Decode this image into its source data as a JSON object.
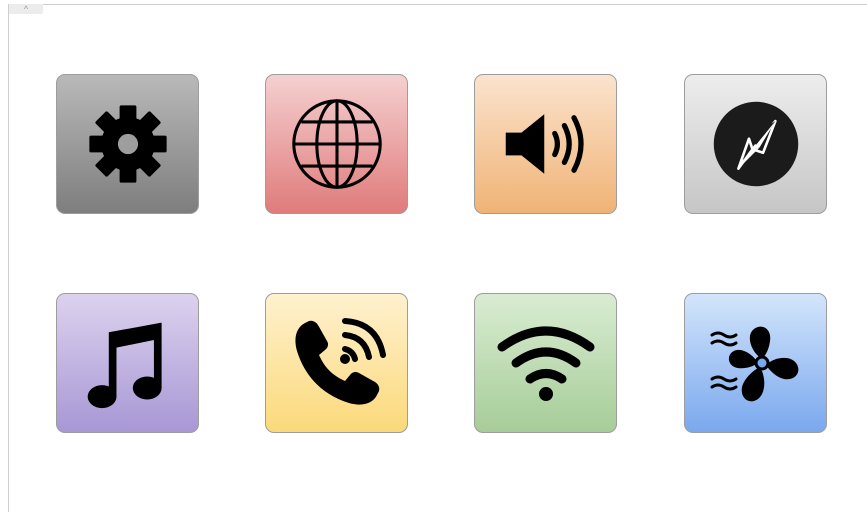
{
  "panel": {
    "collapse_glyph": "^"
  },
  "tiles": [
    {
      "icon": "gear-icon",
      "gradient": [
        "#b9b9b9",
        "#7e7e7e"
      ]
    },
    {
      "icon": "globe-icon",
      "gradient": [
        "#f5d0d0",
        "#e07b7b"
      ]
    },
    {
      "icon": "speaker-icon",
      "gradient": [
        "#fbe3cd",
        "#f0b376"
      ]
    },
    {
      "icon": "compass-icon",
      "gradient": [
        "#ededed",
        "#c6c6c6"
      ]
    },
    {
      "icon": "music-note-icon",
      "gradient": [
        "#dcd2ee",
        "#a897d5"
      ]
    },
    {
      "icon": "phone-call-icon",
      "gradient": [
        "#fff1cf",
        "#fbd97a"
      ]
    },
    {
      "icon": "wifi-icon",
      "gradient": [
        "#d9ecd2",
        "#a6cd98"
      ]
    },
    {
      "icon": "fan-icon",
      "gradient": [
        "#d3e5fb",
        "#7aa8ee"
      ]
    }
  ],
  "colors": {
    "icon": "#000000",
    "tile_border": "#9d9d9d",
    "background": "#ffffff"
  }
}
